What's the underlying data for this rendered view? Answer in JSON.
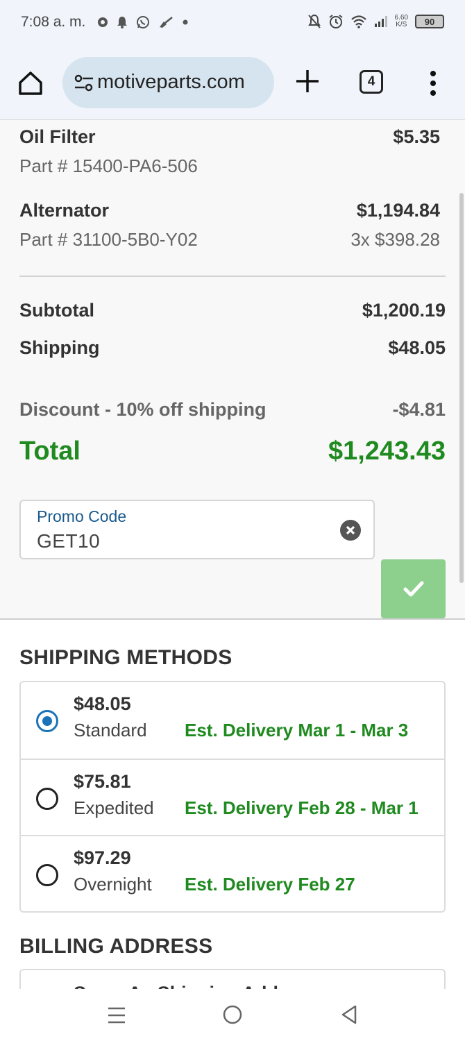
{
  "status_bar": {
    "time": "7:08 a. m.",
    "net_speed": "6.60",
    "net_unit": "K/S",
    "battery": "90"
  },
  "browser": {
    "url": "motiveparts.com",
    "tab_count": "4"
  },
  "order": {
    "items": [
      {
        "name": "Oil Filter",
        "part": "Part # 15400-PA6-506",
        "price": "$5.35",
        "qty": ""
      },
      {
        "name": "Alternator",
        "part": "Part # 31100-5B0-Y02",
        "price": "$1,194.84",
        "qty": "3x $398.28"
      }
    ],
    "subtotal_label": "Subtotal",
    "subtotal": "$1,200.19",
    "shipping_label": "Shipping",
    "shipping": "$48.05",
    "discount_label": "Discount - 10% off shipping",
    "discount": "-$4.81",
    "total_label": "Total",
    "total": "$1,243.43"
  },
  "promo": {
    "label": "Promo Code",
    "value": "GET10"
  },
  "shipping_methods": {
    "title": "SHIPPING METHODS",
    "options": [
      {
        "price": "$48.05",
        "name": "Standard",
        "estimate": "Est. Delivery Mar 1 - Mar 3",
        "selected": true
      },
      {
        "price": "$75.81",
        "name": "Expedited",
        "estimate": "Est. Delivery Feb 28 - Mar 1",
        "selected": false
      },
      {
        "price": "$97.29",
        "name": "Overnight",
        "estimate": "Est. Delivery Feb 27",
        "selected": false
      }
    ]
  },
  "billing": {
    "title": "BILLING ADDRESS",
    "option_label": "Same As Shipping Address"
  },
  "colors": {
    "accent_green": "#1f8a1f",
    "radio_blue": "#1a73b8",
    "apply_button": "#8dd08d",
    "promo_label": "#1a5a8c"
  }
}
